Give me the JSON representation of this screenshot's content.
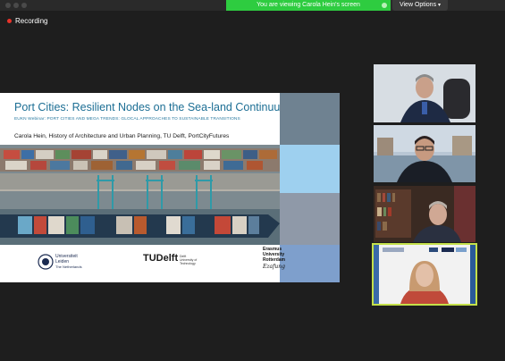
{
  "window": {
    "banner_text": "You are viewing Carola Hein's screen",
    "view_options_label": "View Options",
    "recording_label": "Recording",
    "accent_green": "#2ecc40",
    "recording_red": "#e8332a"
  },
  "slide": {
    "title": "Port Cities: Resilient Nodes on the Sea-land Continuum",
    "subtitle": "EUKN Webinar: PORT CITIES AND MEGA TRENDS: GLOCAL APPROACHES TO SUSTAINABLE TRANSITIONS",
    "author": "Carola Hein, History of Architecture and Urban Planning, TU Delft, PortCityFutures",
    "logos": {
      "leiden_line1": "Universiteit",
      "leiden_line2": "Leiden",
      "leiden_line3": "The Netherlands",
      "tudelft": "TUDelft",
      "tudelft_sub1": "Delft",
      "tudelft_sub2": "University of",
      "tudelft_sub3": "Technology",
      "erasmus_line1": "Erasmus",
      "erasmus_line2": "University",
      "erasmus_line3": "Rotterdam",
      "erasmus_sig": "Ezafung"
    },
    "side_colors": [
      "#6f8291",
      "#9ed0ef",
      "#8f99a8",
      "#7e9fcc"
    ]
  },
  "participants": [
    {
      "icon": "participant-video-1"
    },
    {
      "icon": "participant-video-2"
    },
    {
      "icon": "participant-video-3"
    },
    {
      "icon": "participant-video-4-active-speaker"
    }
  ]
}
